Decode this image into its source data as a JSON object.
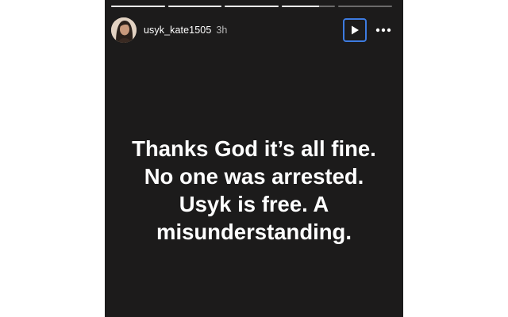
{
  "story": {
    "progress": [
      1,
      1,
      1,
      0.7,
      0
    ],
    "user": {
      "username": "usyk_kate1505",
      "time_ago": "3h",
      "avatar_icon": "profile-photo"
    },
    "controls": {
      "play_icon": "play-icon",
      "more_icon": "more-dots-icon",
      "accent_color": "#3d7be0"
    },
    "text_lines": [
      "Thanks God it’s all fine.",
      "No one was arrested.",
      "Usyk is free. A",
      "misunderstanding."
    ],
    "background_color": "#1c1b1b"
  }
}
